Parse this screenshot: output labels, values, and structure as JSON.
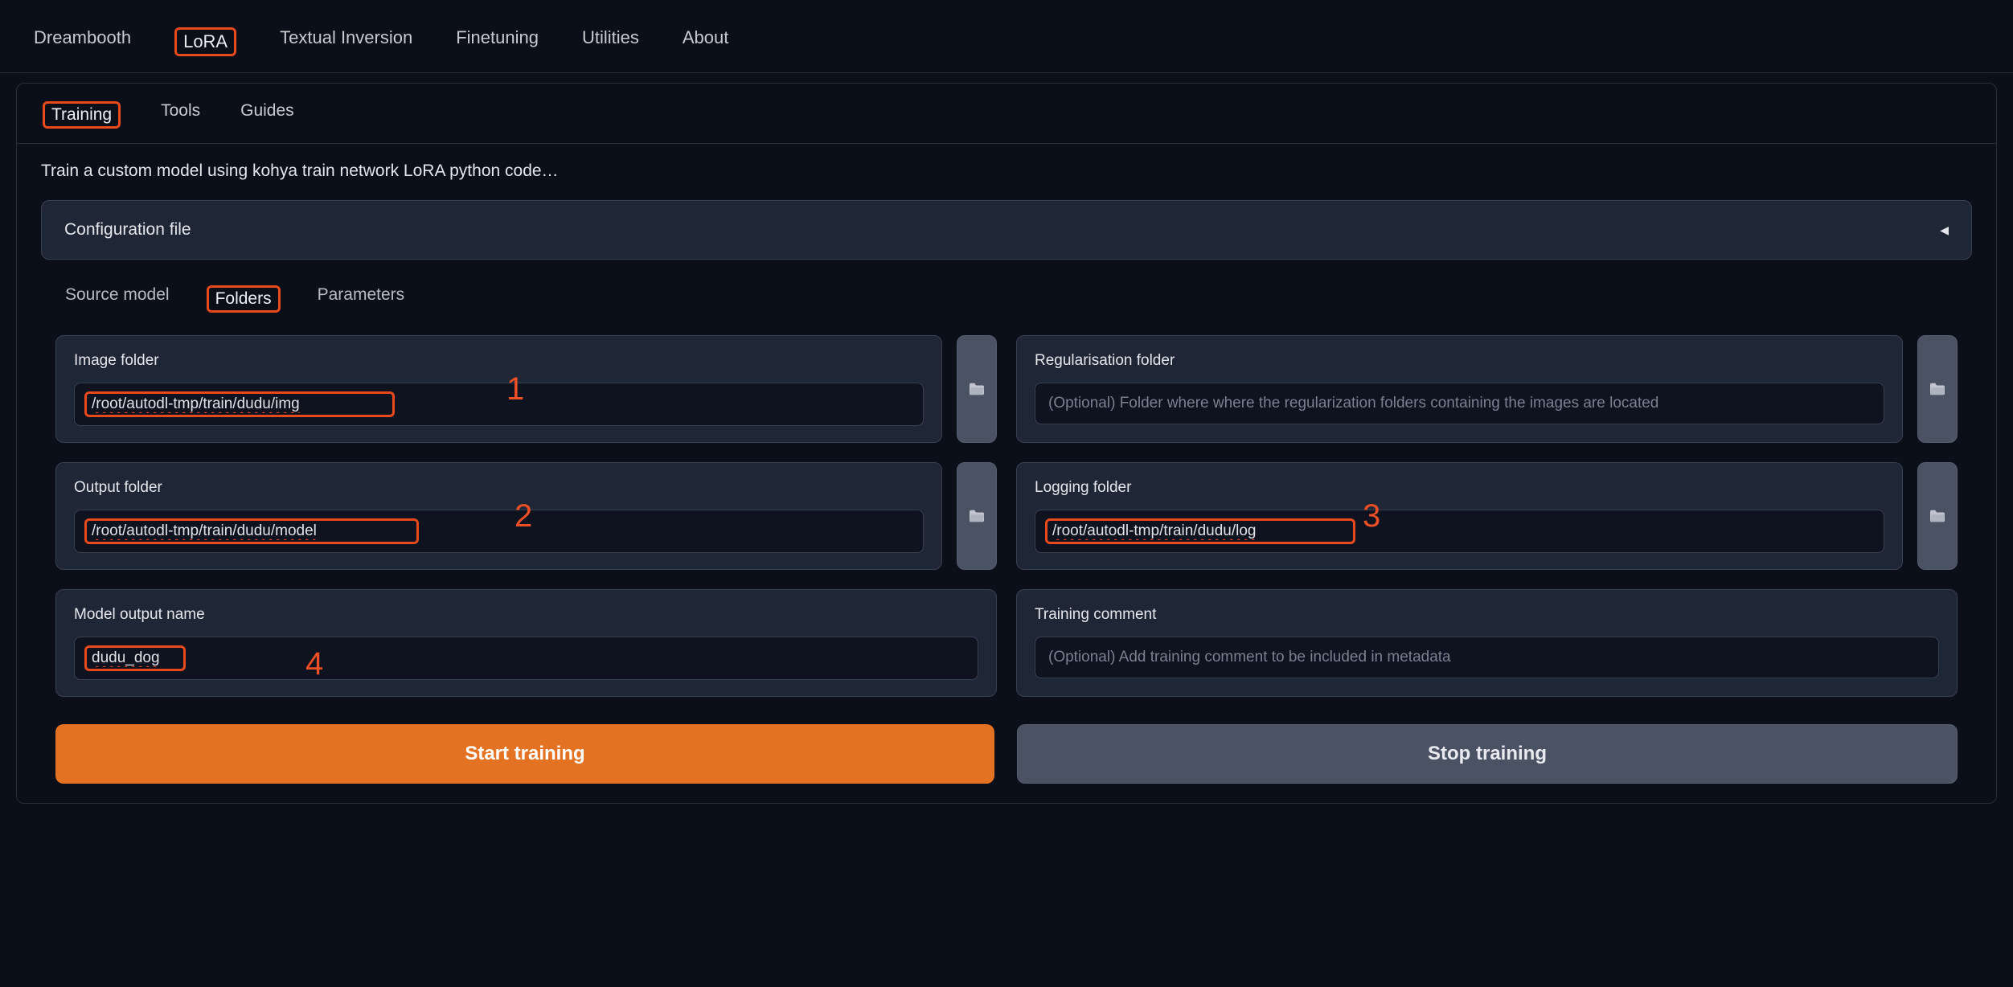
{
  "topTabs": {
    "dreambooth": "Dreambooth",
    "lora": "LoRA",
    "textual": "Textual Inversion",
    "finetuning": "Finetuning",
    "utilities": "Utilities",
    "about": "About"
  },
  "subTabs": {
    "training": "Training",
    "tools": "Tools",
    "guides": "Guides"
  },
  "description": "Train a custom model using kohya train network LoRA python code…",
  "configBar": "Configuration file",
  "innerTabs": {
    "source": "Source model",
    "folders": "Folders",
    "parameters": "Parameters"
  },
  "fields": {
    "imageFolder": {
      "label": "Image folder",
      "value": "/root/autodl-tmp/train/dudu/img"
    },
    "regFolder": {
      "label": "Regularisation folder",
      "placeholder": "(Optional) Folder where where the regularization folders containing the images are located"
    },
    "outputFolder": {
      "label": "Output folder",
      "value": "/root/autodl-tmp/train/dudu/model"
    },
    "loggingFolder": {
      "label": "Logging folder",
      "value": "/root/autodl-tmp/train/dudu/log"
    },
    "modelName": {
      "label": "Model output name",
      "value": "dudu_dog"
    },
    "trainingComment": {
      "label": "Training comment",
      "placeholder": "(Optional) Add training comment to be included in metadata"
    }
  },
  "annotations": {
    "a1": "1",
    "a2": "2",
    "a3": "3",
    "a4": "4"
  },
  "buttons": {
    "start": "Start training",
    "stop": "Stop training"
  }
}
